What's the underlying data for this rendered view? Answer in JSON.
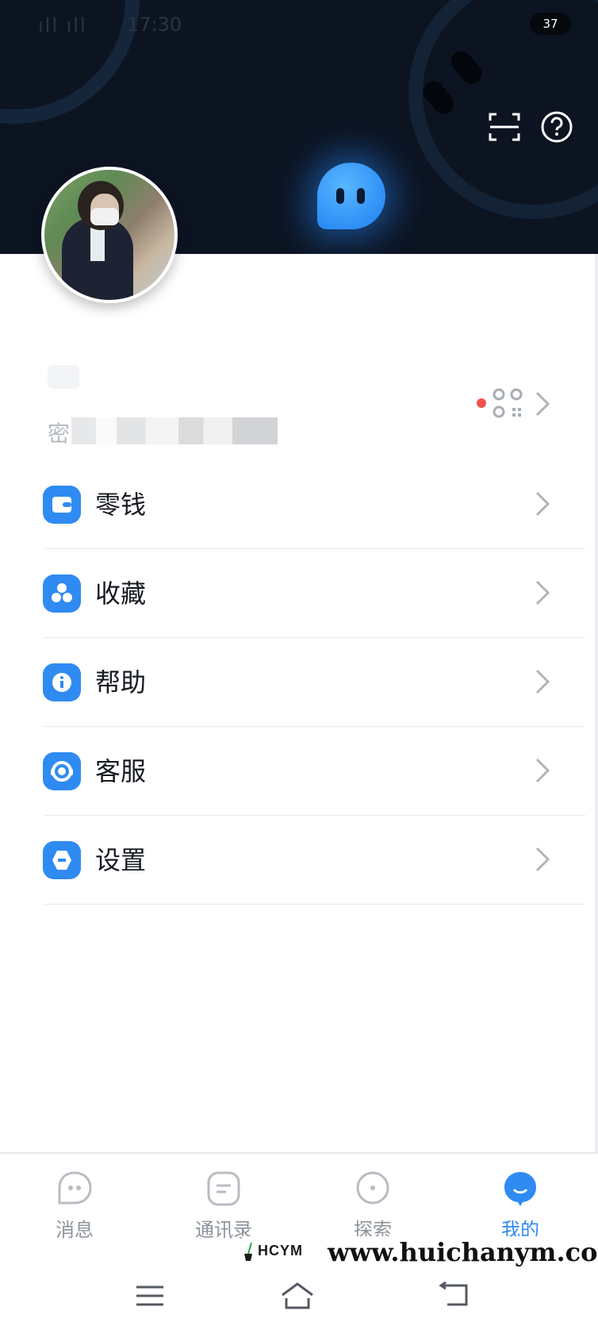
{
  "status_bar": {
    "time": "17:30",
    "signal": "ıll ıll",
    "battery": "37"
  },
  "profile": {
    "id_prefix": "密"
  },
  "menu": [
    {
      "label": "零钱",
      "icon": "wallet-icon"
    },
    {
      "label": "收藏",
      "icon": "favorites-icon"
    },
    {
      "label": "帮助",
      "icon": "info-icon"
    },
    {
      "label": "客服",
      "icon": "headset-icon"
    },
    {
      "label": "设置",
      "icon": "settings-icon"
    }
  ],
  "tabs": [
    {
      "label": "消息",
      "icon": "chat-bubble-icon"
    },
    {
      "label": "通讯录",
      "icon": "contacts-icon"
    },
    {
      "label": "探索",
      "icon": "compass-icon"
    },
    {
      "label": "我的",
      "icon": "profile-icon",
      "active": true
    }
  ],
  "watermark": {
    "logo_text": "HCYM",
    "site": "www.huichanym.com"
  },
  "colors": {
    "header_bg": "#0c1422",
    "accent": "#2f8bf2",
    "red_dot": "#ef5350"
  }
}
